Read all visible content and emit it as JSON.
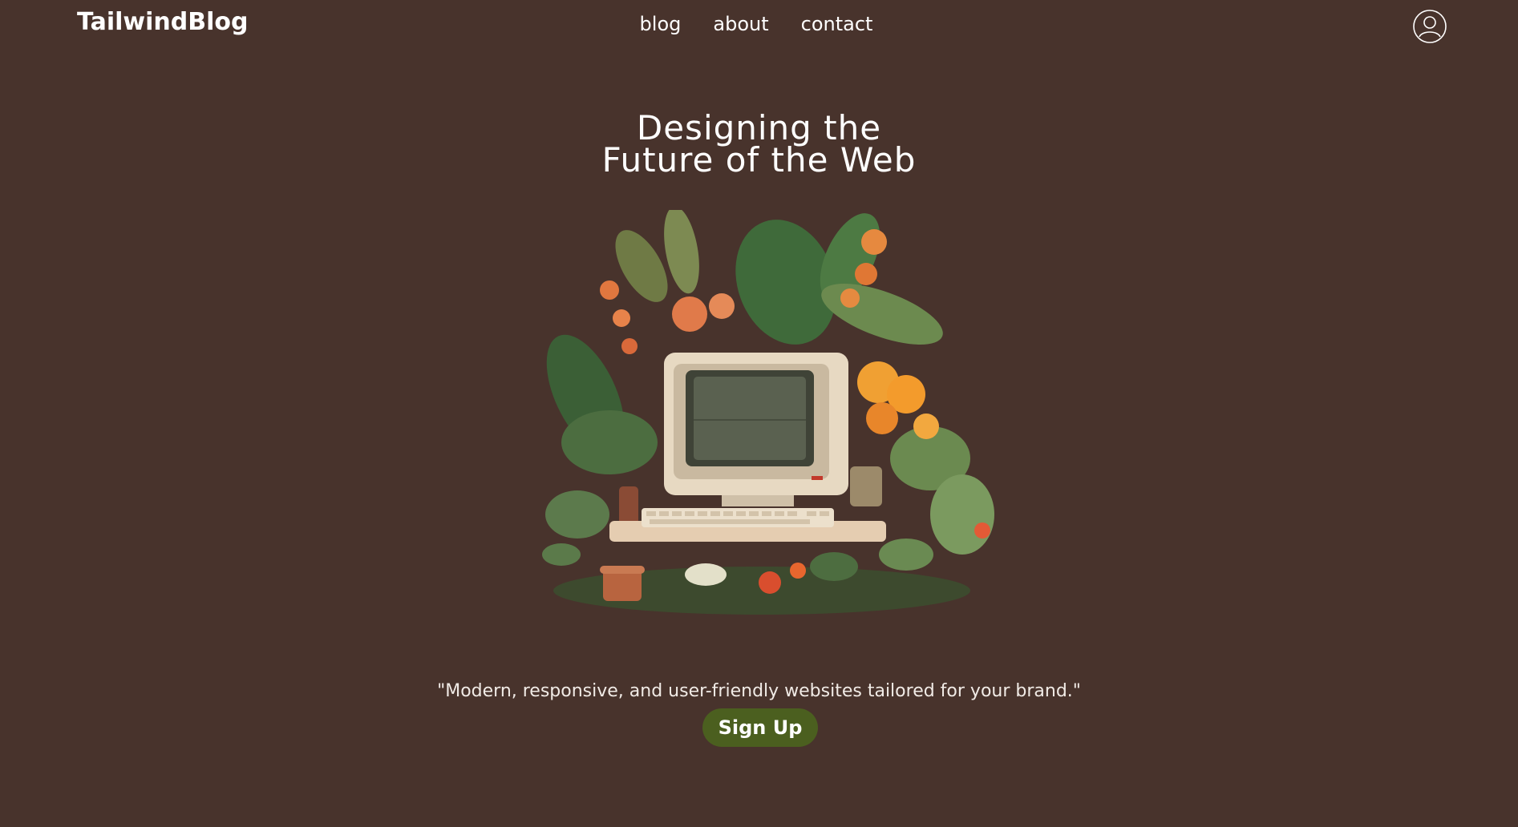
{
  "header": {
    "logo": "TailwindBlog",
    "nav": [
      {
        "label": "blog"
      },
      {
        "label": "about"
      },
      {
        "label": "contact"
      }
    ],
    "user_icon": "user-circle-icon"
  },
  "hero": {
    "title_line1": "Designing the",
    "title_line2": "Future of the Web",
    "illustration": "retro-computer-with-plants-image",
    "tagline": "\"Modern, responsive, and user-friendly websites tailored for your brand.\"",
    "cta_label": "Sign Up"
  },
  "colors": {
    "background": "#48332c",
    "text": "#ffffff",
    "cta": "#4b5f1f"
  }
}
